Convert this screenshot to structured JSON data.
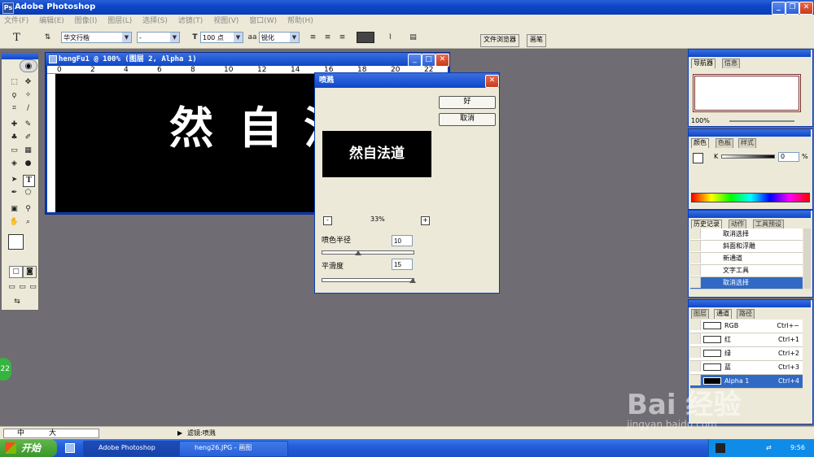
{
  "app": {
    "title": "Adobe Photoshop"
  },
  "menu": [
    "文件(F)",
    "编辑(E)",
    "图像(I)",
    "图层(L)",
    "选择(S)",
    "滤镜(T)",
    "视图(V)",
    "窗口(W)",
    "帮助(H)"
  ],
  "options": {
    "font_family": "华文行楷",
    "font_style": "-",
    "font_size": "100 点",
    "aa_label": "aa",
    "anti_alias": "锐化",
    "tab_file_browser": "文件浏览器",
    "tab_brush": "画笔"
  },
  "document": {
    "title": "hengFu1 @ 100% (图层 2, Alpha 1)",
    "ruler_ticks": [
      "0",
      "2",
      "4",
      "6",
      "8",
      "10",
      "12",
      "14",
      "16",
      "18",
      "20",
      "22"
    ],
    "chars": [
      "然",
      "自",
      "法"
    ]
  },
  "dialog": {
    "title": "喷溅",
    "ok": "好",
    "cancel": "取消",
    "preview_text": "然自法道",
    "zoom": "33%",
    "zoom_minus": "-",
    "zoom_plus": "+",
    "radius_label": "喷色半径",
    "radius_value": "10",
    "radius_level": 0.4,
    "smooth_label": "平滑度",
    "smooth_value": "15",
    "smooth_level": 1.0
  },
  "navigator": {
    "tabs": [
      "导航器",
      "信息"
    ],
    "zoom": "100%"
  },
  "color": {
    "tabs": [
      "颜色",
      "色板",
      "样式"
    ],
    "channel": "K",
    "value": "0",
    "unit": "%"
  },
  "history": {
    "tabs": [
      "历史记录",
      "动作",
      "工具预设"
    ],
    "items": [
      "取消选择",
      "斜面和浮雕",
      "新通道",
      "文字工具",
      "取消选择"
    ]
  },
  "channels": {
    "tabs": [
      "图层",
      "通道",
      "路径"
    ],
    "items": [
      {
        "name": "RGB",
        "shortcut": "Ctrl+~"
      },
      {
        "name": "红",
        "shortcut": "Ctrl+1"
      },
      {
        "name": "绿",
        "shortcut": "Ctrl+2"
      },
      {
        "name": "蓝",
        "shortcut": "Ctrl+3"
      },
      {
        "name": "Alpha 1",
        "shortcut": "Ctrl+4"
      }
    ]
  },
  "status": {
    "text": "滤镜:喷溅",
    "ime": "中",
    "ime_size": "大"
  },
  "taskbar": {
    "start": "开始",
    "tasks": [
      "Adobe Photoshop",
      "heng26.JPG - 画图"
    ],
    "time": "9:56",
    "badge": "22"
  },
  "watermark": {
    "text": "Bai 经验",
    "url": "jingyan.baidu.com"
  }
}
